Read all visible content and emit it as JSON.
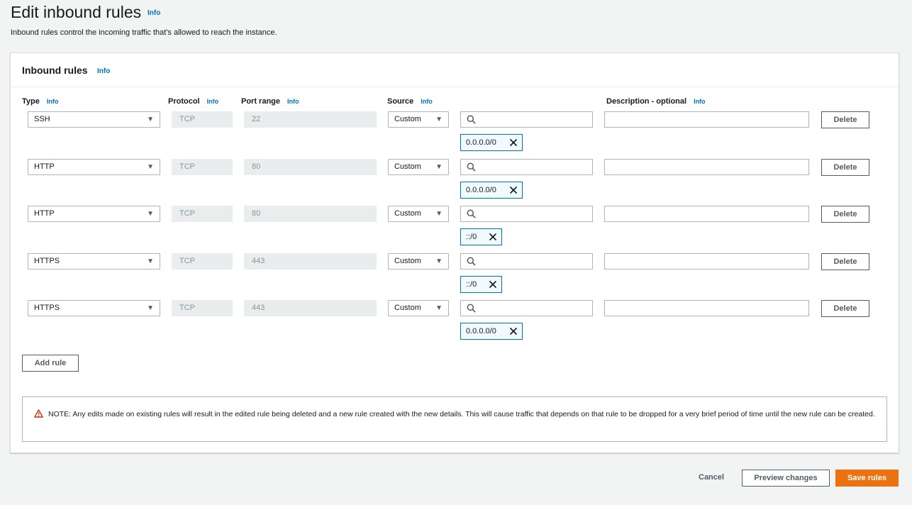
{
  "page": {
    "title": "Edit inbound rules",
    "info": "Info",
    "description": "Inbound rules control the incoming traffic that's allowed to reach the instance."
  },
  "panel": {
    "title": "Inbound rules",
    "info": "Info",
    "columns": {
      "type": "Type",
      "protocol": "Protocol",
      "port_range": "Port range",
      "source": "Source",
      "description": "Description - optional",
      "info": "Info"
    }
  },
  "rules": [
    {
      "type": "SSH",
      "protocol": "TCP",
      "port": "22",
      "source": "Custom",
      "cidr": "0.0.0.0/0",
      "description": ""
    },
    {
      "type": "HTTP",
      "protocol": "TCP",
      "port": "80",
      "source": "Custom",
      "cidr": "0.0.0.0/0",
      "description": ""
    },
    {
      "type": "HTTP",
      "protocol": "TCP",
      "port": "80",
      "source": "Custom",
      "cidr": "::/0",
      "description": ""
    },
    {
      "type": "HTTPS",
      "protocol": "TCP",
      "port": "443",
      "source": "Custom",
      "cidr": "::/0",
      "description": ""
    },
    {
      "type": "HTTPS",
      "protocol": "TCP",
      "port": "443",
      "source": "Custom",
      "cidr": "0.0.0.0/0",
      "description": ""
    }
  ],
  "buttons": {
    "delete": "Delete",
    "add_rule": "Add rule",
    "cancel": "Cancel",
    "preview": "Preview changes",
    "save": "Save rules"
  },
  "notice": "NOTE: Any edits made on existing rules will result in the edited rule being deleted and a new rule created with the new details. This will cause traffic that depends on that rule to be dropped for a very brief period of time until the new rule can be created.",
  "icons": {
    "dropdown": "caret-down-icon",
    "search": "search-icon",
    "remove": "close-icon",
    "warning": "warning-icon"
  },
  "colors": {
    "accent": "#0073bb",
    "primary_button": "#ec7211",
    "warning": "#d13212"
  }
}
